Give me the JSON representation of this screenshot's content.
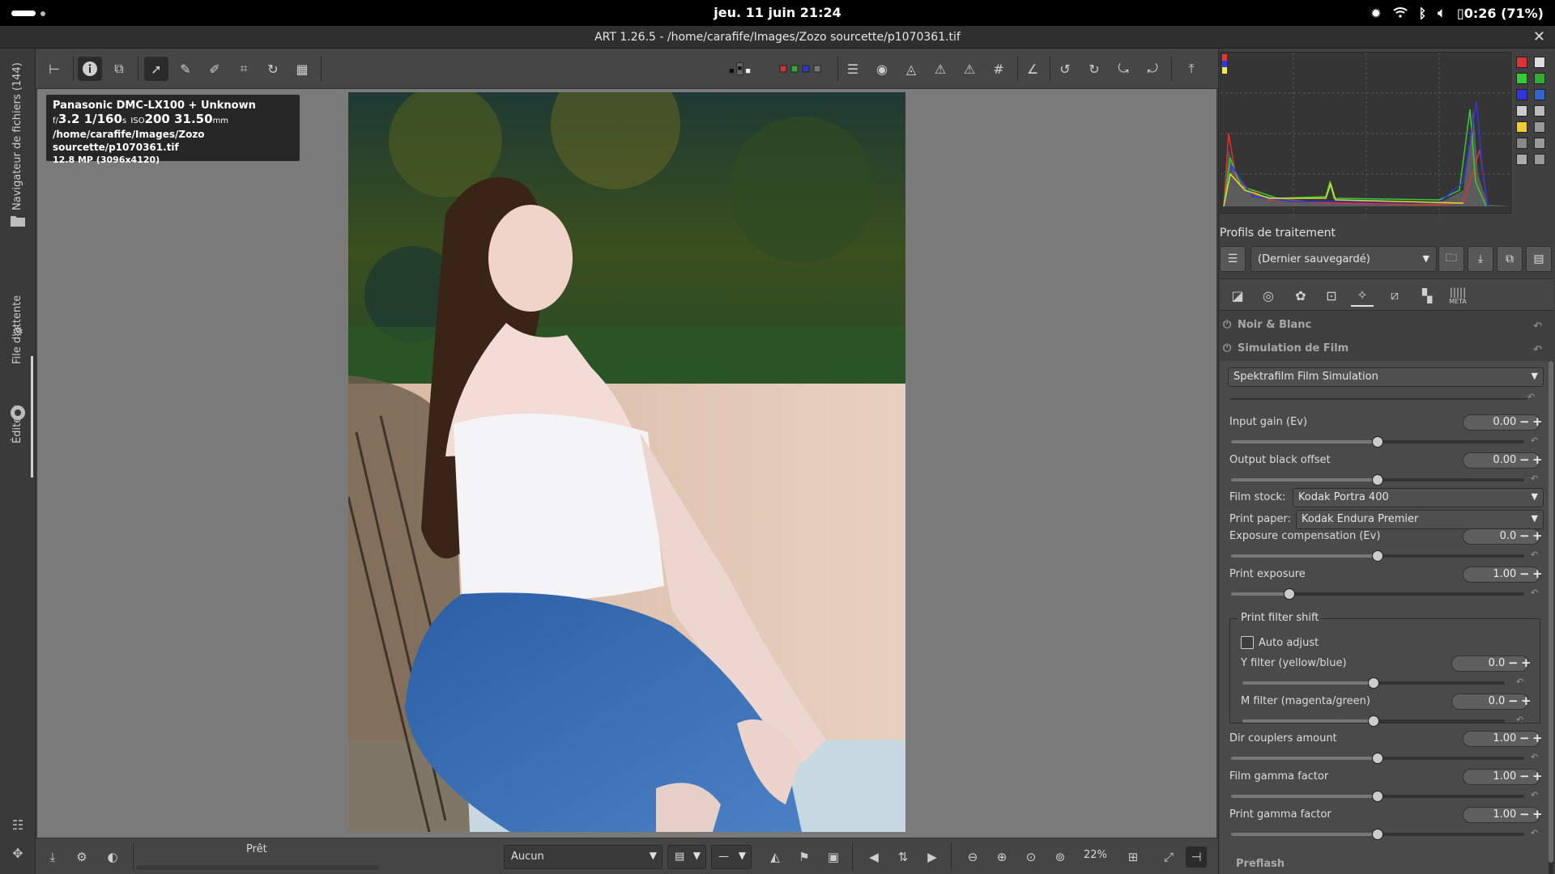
{
  "system": {
    "clock": "jeu. 11 juin  21:24",
    "battery": "0:26 (71%)"
  },
  "window": {
    "title": "ART 1.26.5 - /home/carafife/Images/Zozo sourcette/p1070361.tif"
  },
  "left_tabs": {
    "file_browser": "Navigateur de fichiers (144)",
    "queue": "File d'attente",
    "editor": "Éditeur"
  },
  "info": {
    "camera": "Panasonic DMC-LX100 + Unknown",
    "aperture_prefix": "f/",
    "aperture": "3.2",
    "shutter": "1/160",
    "shutter_unit": "s",
    "iso_prefix": "ISO",
    "iso": "200",
    "focal": "31.50",
    "focal_unit": "mm",
    "path": "/home/carafife/Images/Zozo sourcette/p1070361.tif",
    "size": "12.8 MP (3096x4120)"
  },
  "bottom": {
    "status": "Prêt",
    "output_profile": "Aucun",
    "zoom": "22%"
  },
  "profiles": {
    "label": "Profils de traitement",
    "selected": "(Dernier sauvegardé)"
  },
  "tabs": {
    "meta": "META"
  },
  "modules": {
    "bw": "Noir & Blanc",
    "film_sim": "Simulation de Film",
    "preset": "Spektrafilm Film Simulation"
  },
  "params": [
    {
      "label": "Input gain (Ev)",
      "value": "0.00",
      "fraction": 0.5
    },
    {
      "label": "Output black offset",
      "value": "0.00",
      "fraction": 0.5
    },
    {
      "label": "Exposure compensation (Ev)",
      "value": "0.0",
      "fraction": 0.5
    },
    {
      "label": "Print exposure",
      "value": "1.00",
      "fraction": 0.2
    },
    {
      "label": "Dir couplers amount",
      "value": "1.00",
      "fraction": 0.5
    },
    {
      "label": "Film gamma factor",
      "value": "1.00",
      "fraction": 0.5
    },
    {
      "label": "Print gamma factor",
      "value": "1.00",
      "fraction": 0.5
    }
  ],
  "film_stock": {
    "label": "Film stock:",
    "value": "Kodak Portra 400"
  },
  "print_paper": {
    "label": "Print paper:",
    "value": "Kodak Endura Premier"
  },
  "print_filter": {
    "title": "Print filter shift",
    "auto_adjust": "Auto adjust",
    "y_filter": {
      "label": "Y filter (yellow/blue)",
      "value": "0.0",
      "fraction": 0.5
    },
    "m_filter": {
      "label": "M filter (magenta/green)",
      "value": "0.0",
      "fraction": 0.5
    }
  },
  "next_module": "Preflash",
  "colors": {
    "accent": "#e0e0e0",
    "panel": "#4a4a4a",
    "viewer": "#7a7a7a"
  }
}
